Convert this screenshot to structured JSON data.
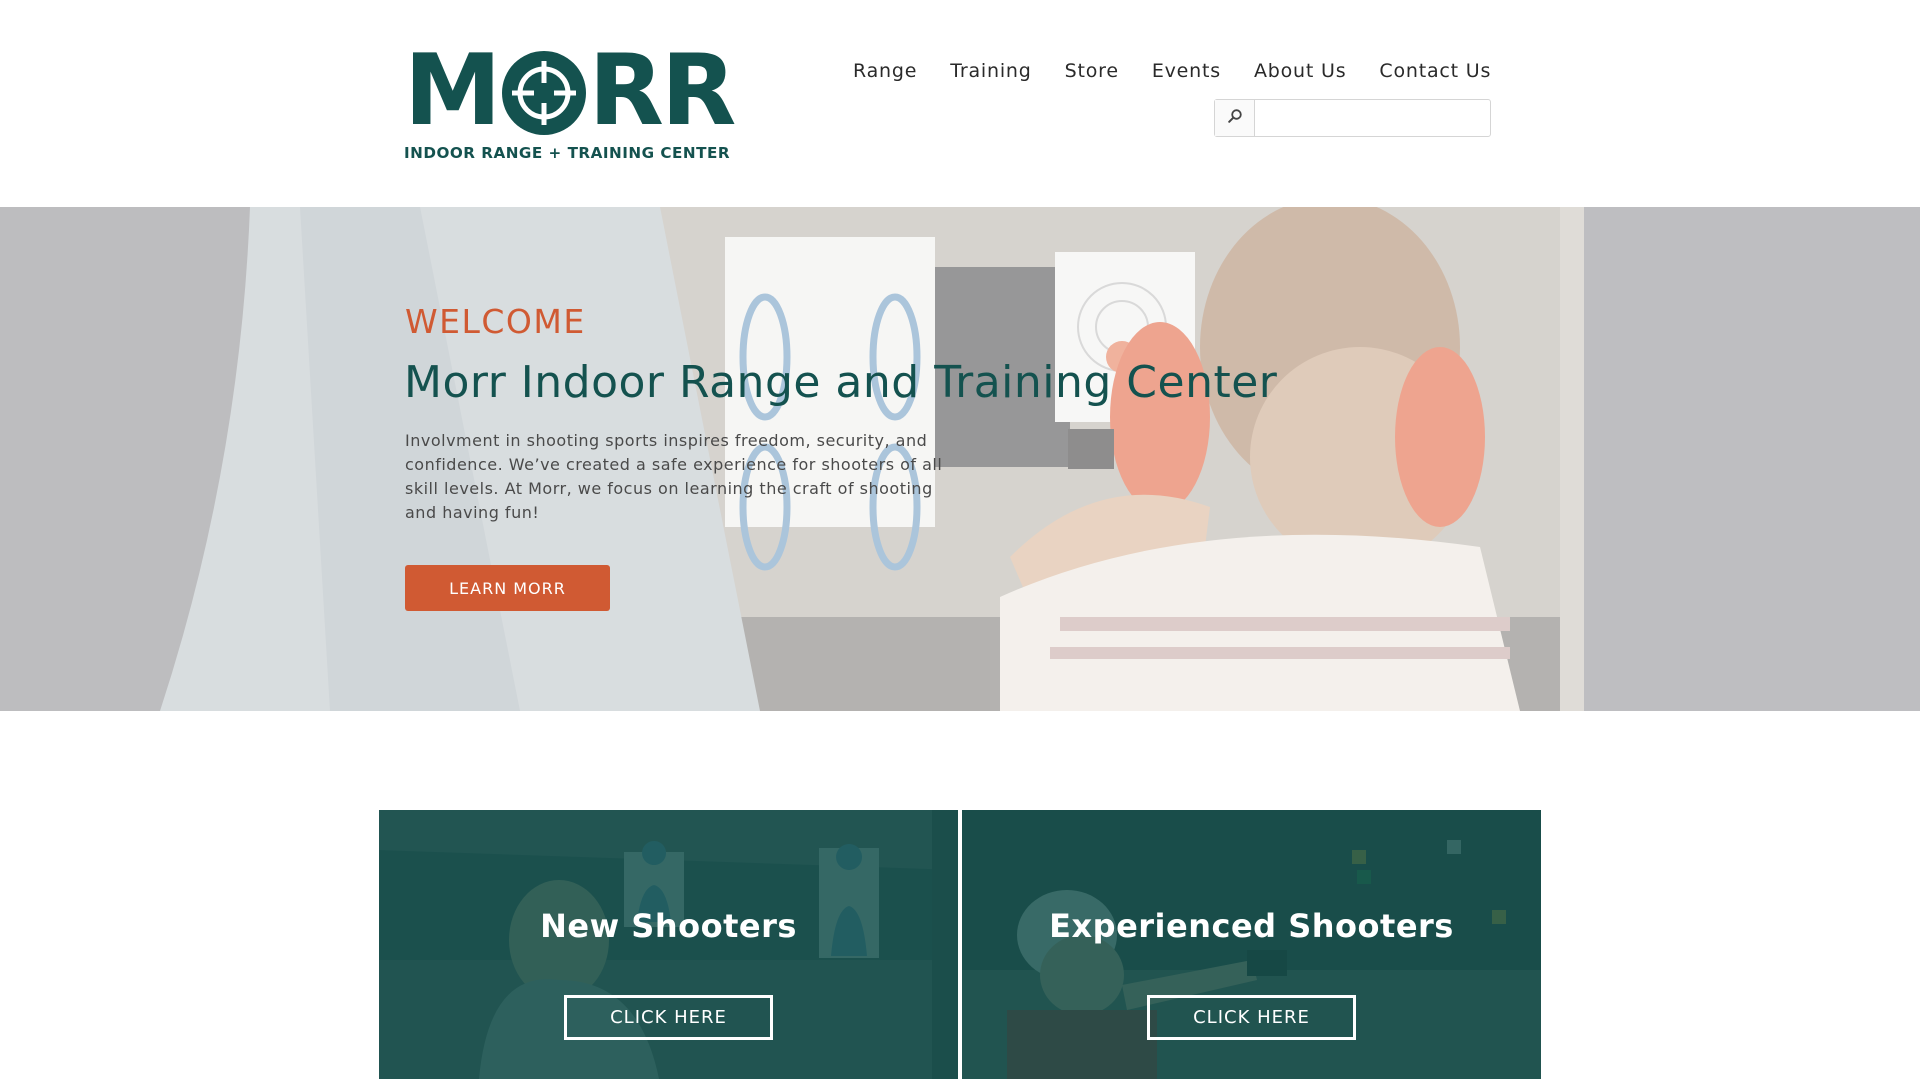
{
  "header": {
    "logo": {
      "word_before": "M",
      "word_after": "RR",
      "tagline": "INDOOR RANGE + TRAINING CENTER",
      "color": "#14524f",
      "icon": "crosshair-icon"
    },
    "nav": {
      "items": [
        {
          "label": "Range"
        },
        {
          "label": "Training"
        },
        {
          "label": "Store"
        },
        {
          "label": "Events"
        },
        {
          "label": "About Us"
        },
        {
          "label": "Contact Us"
        }
      ]
    },
    "search": {
      "icon": "search-icon",
      "value": "",
      "placeholder": ""
    }
  },
  "hero": {
    "eyebrow": "WELCOME",
    "title": "Morr Indoor Range and Training Center",
    "text": "Involvment in shooting sports inspires freedom, security, and confidence. We’ve created a safe experience for shooters of all skill levels. At Morr, we focus on learning the craft of shooting and having fun!",
    "button_label": "LEARN MORR",
    "background": "photo of an instructor and a young shooter with ear protection at an indoor range"
  },
  "cards": [
    {
      "title": "New Shooters",
      "button_label": "CLICK HERE"
    },
    {
      "title": "Experienced Shooters",
      "button_label": "CLICK HERE"
    }
  ],
  "colors": {
    "brand_teal": "#14524f",
    "accent_orange": "#d05a33",
    "card_overlay": "#114e4b"
  }
}
